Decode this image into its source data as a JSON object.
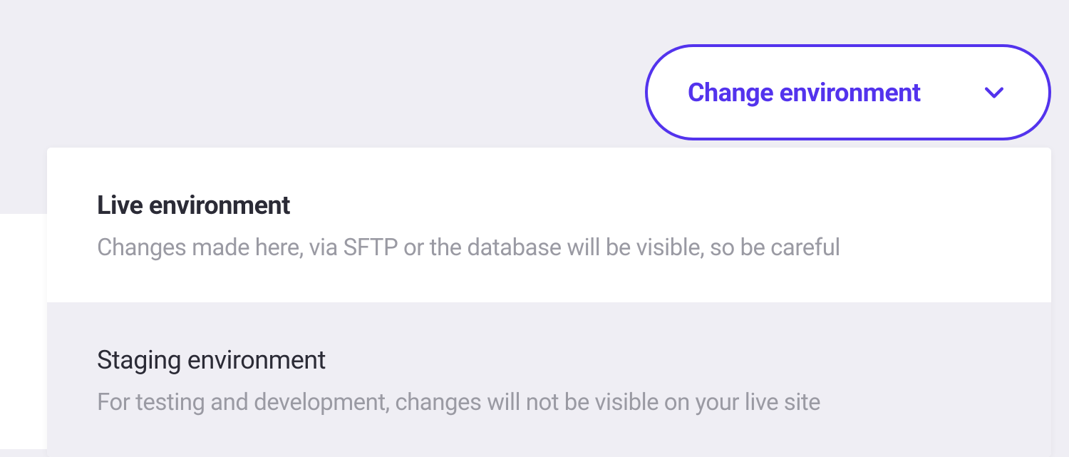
{
  "button": {
    "label": "Change environment"
  },
  "options": [
    {
      "title": "Live environment",
      "description": "Changes made here, via SFTP or the database will be visible, so be careful"
    },
    {
      "title": "Staging environment",
      "description": "For testing and development, changes will not be visible on your live site"
    }
  ]
}
